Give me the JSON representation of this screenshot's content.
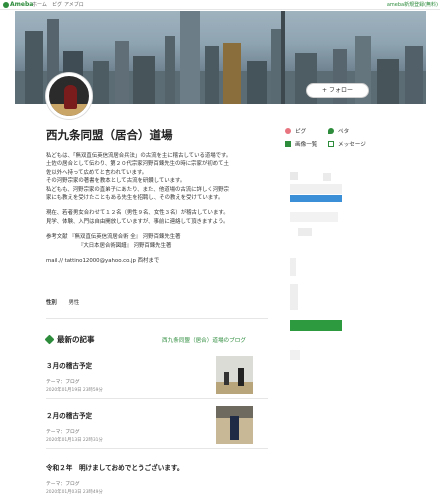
{
  "topbar": {
    "logo_text": "Ameba",
    "nav": [
      "ホーム",
      "ピグ",
      "アメブロ"
    ],
    "right_text": "ameba新規登録(無料)"
  },
  "header": {
    "follow_label": "+ フォロー"
  },
  "blog": {
    "title": "西九条同盟（居合）道場",
    "intro": [
      "私どもは、「無双直伝英信流居合兵法」の古流を主に稽古している道場です。",
      "土佐の居合として伝わり、第２０代宗家河野百錬先生の時に宗家が初めて土",
      "佐以外へ持って広めてと言われています。",
      "その河野宗家の著書を教本として古流を研鑽しています。",
      "私どもも、河野宗家の直弟子にあたり、また、他道場の古流に詳しく河野宗",
      "家にも教えを受けたこともある先生を招聘し、その教えを受けています。",
      "",
      "現在、若者男女合わせて１２名（男性９名、女性３名）が稽古しています。",
      "見学、体験、入門は自由開放していますが、事前に連絡して頂きますよう。",
      "",
      "参考文献 『無双直伝英信流居合術 全』 河野百錬先生著",
      "『大日本居合術図譜』 河野百錬先生著",
      "",
      "mail.// tattino12000@yahoo.co.jp 西村まで"
    ],
    "gender_label": "性別",
    "gender_value": "男性"
  },
  "recent": {
    "heading": "最新の記事",
    "link": "西九条同盟（居合）道場のブログ",
    "entries": [
      {
        "title": "３月の稽古予定",
        "theme": "テーマ：ブログ",
        "date": "2020年01月19日 23時59分"
      },
      {
        "title": "２月の稽古予定",
        "theme": "テーマ：ブログ",
        "date": "2020年01月13日 22時31分"
      },
      {
        "title": "令和２年　明けましておめでとうございます。",
        "theme": "テーマ：ブログ",
        "date": "2020年01月03日 23時49分"
      }
    ]
  },
  "sidebar": {
    "links": [
      {
        "icon": "piggy-icon",
        "label": "ピグ"
      },
      {
        "icon": "bird-icon",
        "label": "ペタ"
      },
      {
        "icon": "image-icon",
        "label": "画像一覧"
      },
      {
        "icon": "mail-icon",
        "label": "メッセージ"
      }
    ]
  },
  "colors": {
    "accent": "#2d8c3c",
    "bar_blue": "#3a8fd6",
    "bar_green": "#2e9a3f"
  }
}
